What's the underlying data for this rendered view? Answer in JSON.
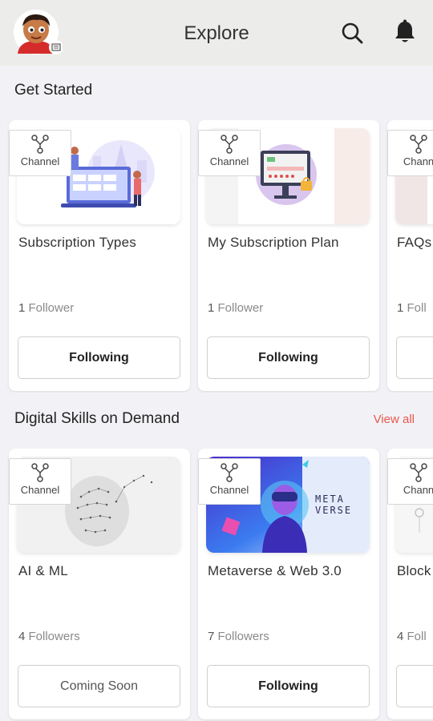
{
  "header": {
    "title": "Explore",
    "icons": [
      "avatar",
      "search-icon",
      "bell-icon"
    ]
  },
  "sections": [
    {
      "title": "Get Started",
      "view_all": "",
      "cards": [
        {
          "tag": "Channel",
          "title": "Subscription Types",
          "follower_count": "1",
          "follower_label": "Follower",
          "button": "Following"
        },
        {
          "tag": "Channel",
          "title": "My Subscription Plan",
          "follower_count": "1",
          "follower_label": "Follower",
          "button": "Following"
        },
        {
          "tag": "Chann",
          "title": "FAQs",
          "follower_count": "1",
          "follower_label": "Foll",
          "button": ""
        }
      ]
    },
    {
      "title": "Digital Skills on Demand",
      "view_all": "View all",
      "cards": [
        {
          "tag": "Channel",
          "title": "AI & ML",
          "follower_count": "4",
          "follower_label": "Followers",
          "button": "Coming Soon"
        },
        {
          "tag": "Channel",
          "title": "Metaverse & Web 3.0",
          "follower_count": "7",
          "follower_label": "Followers",
          "button": "Following",
          "image_text": "META VERSE"
        },
        {
          "tag": "Chann",
          "title": "Block",
          "follower_count": "4",
          "follower_label": "Foll",
          "button": ""
        }
      ]
    }
  ],
  "colors": {
    "accent": "#e8584b",
    "header_bg": "#ececea",
    "page_bg": "#f2f2f6"
  }
}
